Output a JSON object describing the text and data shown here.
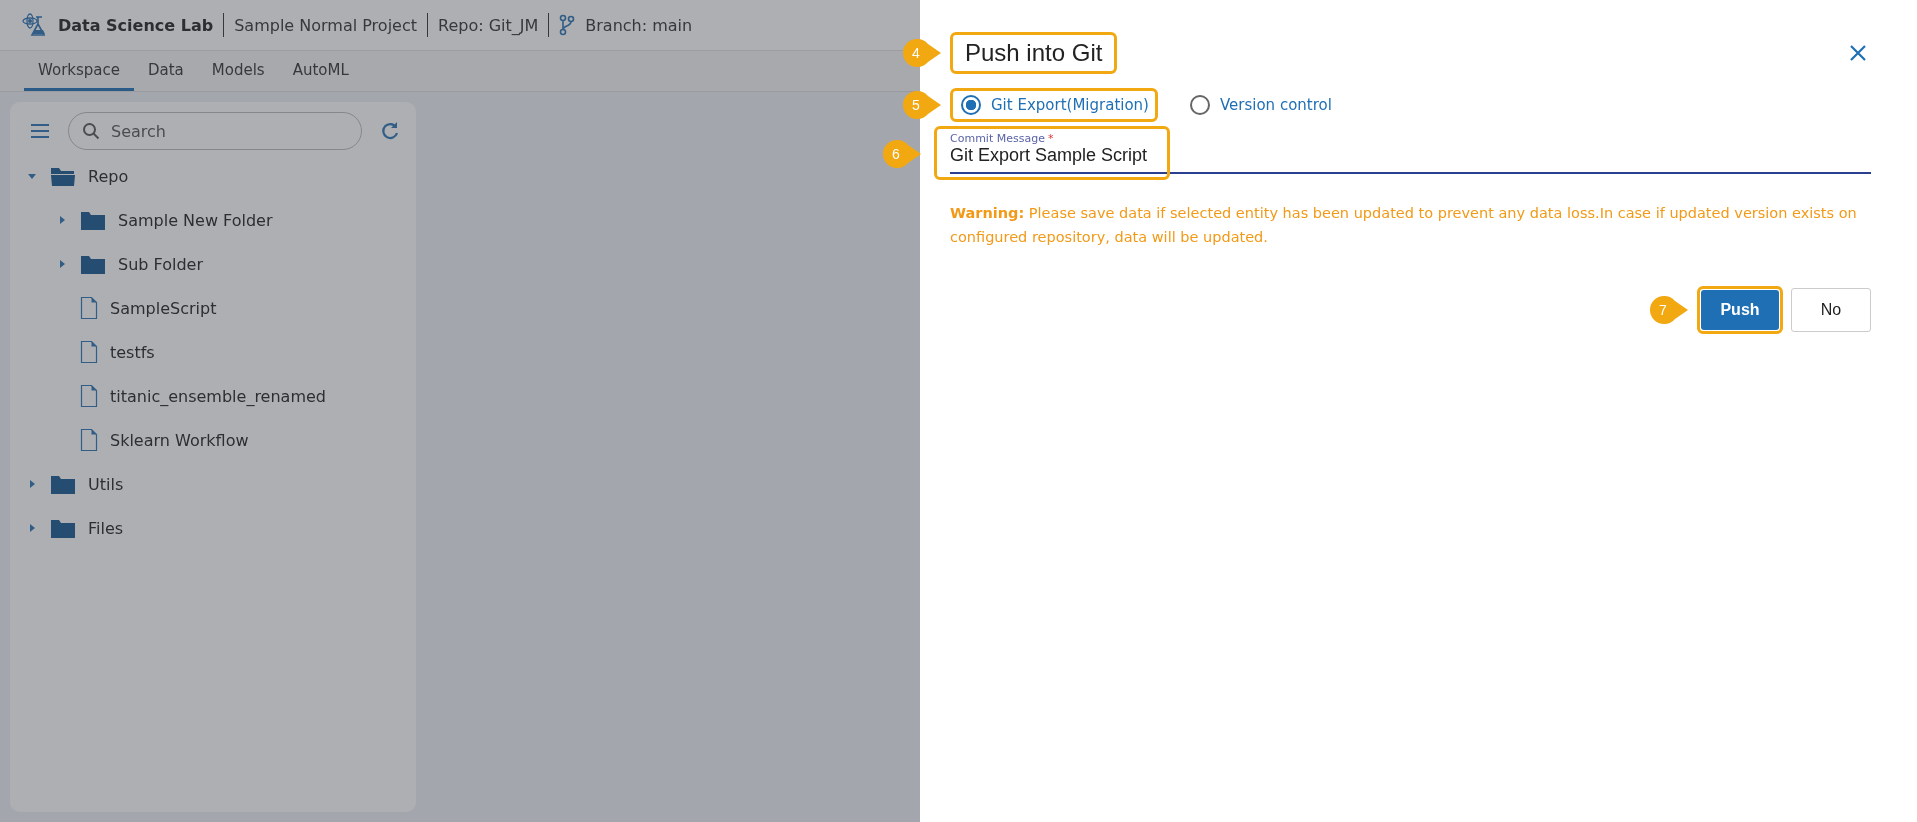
{
  "header": {
    "app_title": "Data Science Lab",
    "project": "Sample Normal Project",
    "repo": "Repo: Git_JM",
    "branch": "Branch: main"
  },
  "tabs": [
    {
      "label": "Workspace",
      "selected": true
    },
    {
      "label": "Data",
      "selected": false
    },
    {
      "label": "Models",
      "selected": false
    },
    {
      "label": "AutoML",
      "selected": false
    }
  ],
  "sidebar": {
    "search": {
      "placeholder": "Search"
    },
    "tree": [
      {
        "kind": "folder",
        "label": "Repo",
        "expanded": true,
        "children": [
          {
            "kind": "folder",
            "label": "Sample New Folder",
            "expanded": false
          },
          {
            "kind": "folder",
            "label": "Sub Folder",
            "expanded": false
          },
          {
            "kind": "file",
            "label": "SampleScript"
          },
          {
            "kind": "file",
            "label": "testfs"
          },
          {
            "kind": "file",
            "label": "titanic_ensemble_renamed"
          },
          {
            "kind": "file",
            "label": "Sklearn Workflow"
          }
        ]
      },
      {
        "kind": "folder",
        "label": "Utils",
        "expanded": false
      },
      {
        "kind": "folder",
        "label": "Files",
        "expanded": false
      }
    ]
  },
  "dialog": {
    "title": {
      "text": "Push into Git",
      "callout": "4"
    },
    "options": [
      {
        "label": "Git Export(Migration)",
        "selected": true,
        "callout": "5"
      },
      {
        "label": "Version control",
        "selected": false
      }
    ],
    "commit_field": {
      "label": "Commit Message",
      "required_mark": "*",
      "value": "Git Export Sample Script",
      "callout": "6"
    },
    "warning": "**Warning:** Please save data if selected entity has been updated to prevent any data loss.In case if updated version exists on configured repository, data will be updated.",
    "buttons": [
      {
        "label": "Push",
        "kind": "primary",
        "callout": "7"
      },
      {
        "label": "No",
        "kind": "secondary"
      }
    ]
  }
}
